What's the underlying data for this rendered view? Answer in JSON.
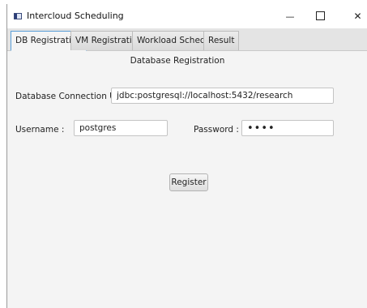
{
  "window": {
    "title": "Intercloud Scheduling",
    "minimize_glyph": "—",
    "close_glyph": "✕"
  },
  "tabs": [
    {
      "label": "DB Registration",
      "active": true
    },
    {
      "label": "VM Registration",
      "active": false
    },
    {
      "label": "Workload Schedule",
      "active": false
    },
    {
      "label": "Result",
      "active": false
    }
  ],
  "form": {
    "section_title": "Database Registration",
    "url_label": "Database Connection URL :",
    "url_value": "jdbc:postgresql://localhost:5432/research",
    "username_label": "Username :",
    "username_value": "postgres",
    "password_label": "Password :",
    "password_value": "1234",
    "register_label": "Register"
  },
  "icons": {
    "app": "app-window-icon",
    "minimize": "minimize-icon",
    "maximize": "maximize-icon",
    "close": "close-icon"
  },
  "colors": {
    "active_tab_border": "#5a9fd8",
    "content_background": "#f4f4f4"
  }
}
